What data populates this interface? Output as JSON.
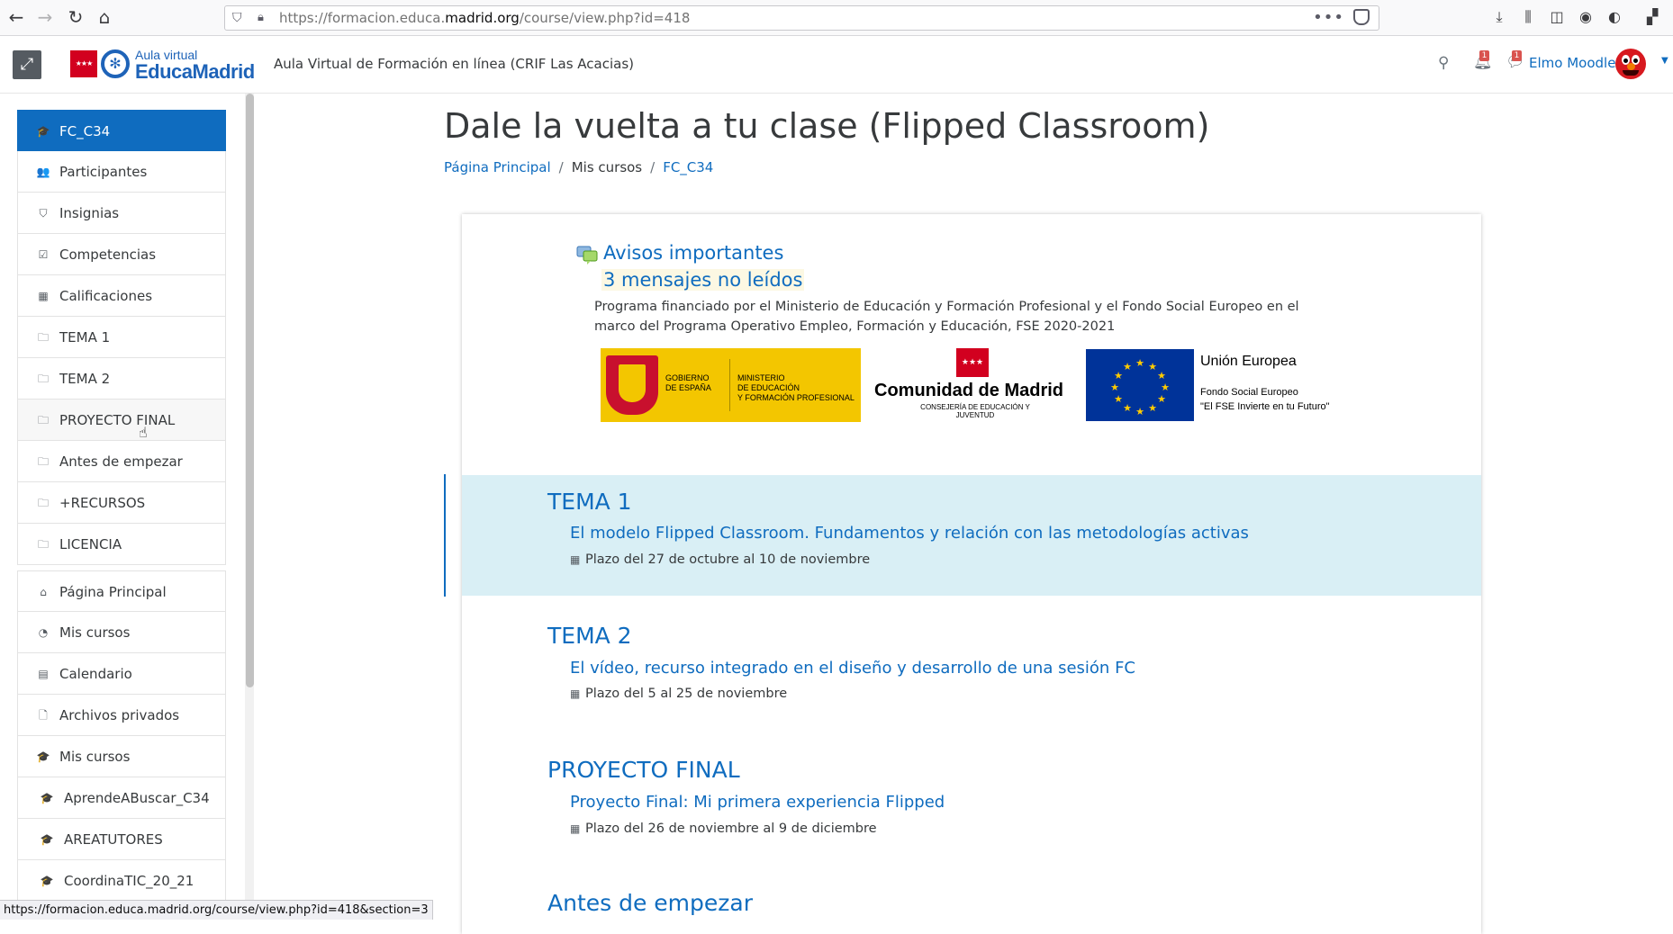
{
  "browser": {
    "url_prefix": "https://formacion.educa.",
    "url_domain": "madrid.org",
    "url_suffix": "/course/view.php?id=418",
    "more_label": "•••"
  },
  "header": {
    "logo_small": "Aula virtual",
    "logo_big": "EducaMadrid",
    "site_name": "Aula Virtual de Formación en línea (CRIF Las Acacias)",
    "notif_count": "1",
    "msg_count": "1",
    "user_name": "Elmo Moodler"
  },
  "nav": {
    "course_items": [
      {
        "label": "FC_C34",
        "icon": "graduation-cap-icon",
        "glyph": "🎓"
      },
      {
        "label": "Participantes",
        "icon": "users-icon",
        "glyph": "👥"
      },
      {
        "label": "Insignias",
        "icon": "shield-icon",
        "glyph": "⛉"
      },
      {
        "label": "Competencias",
        "icon": "check-square-icon",
        "glyph": "☑"
      },
      {
        "label": "Calificaciones",
        "icon": "table-icon",
        "glyph": "▦"
      },
      {
        "label": "TEMA 1",
        "icon": "folder-icon",
        "glyph": "🗀"
      },
      {
        "label": "TEMA 2",
        "icon": "folder-icon",
        "glyph": "🗀"
      },
      {
        "label": "PROYECTO FINAL",
        "icon": "folder-icon",
        "glyph": "🗀"
      },
      {
        "label": "Antes de empezar",
        "icon": "folder-icon",
        "glyph": "🗀"
      },
      {
        "label": "+RECURSOS",
        "icon": "folder-icon",
        "glyph": "🗀"
      },
      {
        "label": "LICENCIA",
        "icon": "folder-icon",
        "glyph": "🗀"
      }
    ],
    "site_items": [
      {
        "label": "Página Principal",
        "icon": "home-icon",
        "glyph": "⌂"
      },
      {
        "label": "Mis cursos",
        "icon": "dashboard-icon",
        "glyph": "◔"
      },
      {
        "label": "Calendario",
        "icon": "calendar-icon",
        "glyph": "▤"
      },
      {
        "label": "Archivos privados",
        "icon": "file-icon",
        "glyph": "🗋"
      },
      {
        "label": "Mis cursos",
        "icon": "graduation-cap-icon",
        "glyph": "🎓"
      }
    ],
    "course_list": [
      {
        "label": "AprendeABuscar_C34",
        "glyph": "🎓"
      },
      {
        "label": "AREATUTORES",
        "glyph": "🎓"
      },
      {
        "label": "CoordinaTIC_20_21",
        "glyph": "🎓"
      }
    ]
  },
  "main": {
    "title": "Dale la vuelta a tu clase (Flipped Classroom)",
    "breadcrumb": [
      "Página Principal",
      "Mis cursos",
      "FC_C34"
    ],
    "breadcrumb_sep": "/",
    "forum_label": "Avisos importantes",
    "unread_label": "3 mensajes no leídos",
    "funding_text": "Programa financiado por el Ministerio de Educación y Formación Profesional y el Fondo Social Europeo en el marco del Programa Operativo Empleo, Formación y Educación, FSE 2020-2021",
    "logos": {
      "gob_left": [
        "GOBIERNO",
        "DE ESPAÑA"
      ],
      "gob_right": [
        "MINISTERIO",
        "DE EDUCACIÓN",
        "Y FORMACIÓN PROFESIONAL"
      ],
      "cm_name": "Comunidad de Madrid",
      "cm_sub": "CONSEJERÍA DE EDUCACIÓN Y JUVENTUD",
      "eu_title": "Unión Europea",
      "eu_line1": "Fondo Social Europeo",
      "eu_line2": "\"El FSE Invierte en tu Futuro\""
    },
    "sections": [
      {
        "title": "TEMA 1",
        "activity": "El modelo Flipped Classroom. Fundamentos y relación con las metodologías activas",
        "date": "Plazo del 27 de octubre al 10 de noviembre"
      },
      {
        "title": "TEMA 2",
        "activity": "El vídeo, recurso integrado en el diseño y desarrollo de una sesión FC",
        "date": "Plazo del 5 al 25 de noviembre"
      },
      {
        "title": "PROYECTO FINAL",
        "activity": "Proyecto Final: Mi primera experiencia Flipped",
        "date": "Plazo del 26 de noviembre al 9 de diciembre"
      },
      {
        "title": "Antes de empezar"
      }
    ]
  },
  "status_url": "https://formacion.educa.madrid.org/course/view.php?id=418&section=3",
  "colors": {
    "accent": "#0f6cbf",
    "current_section": "#d9eff5",
    "badge": "#d9534f"
  }
}
